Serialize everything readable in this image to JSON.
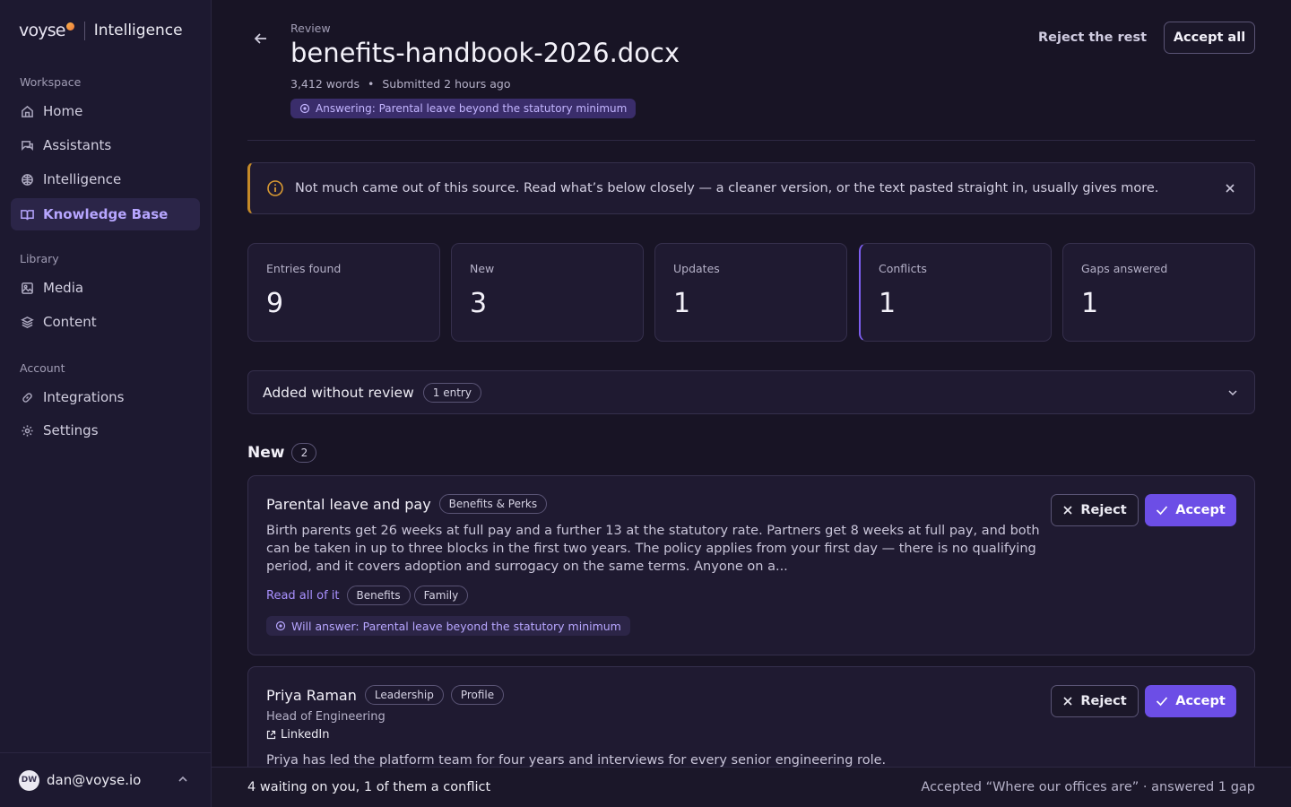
{
  "brand": {
    "logo": "voyse",
    "product": "Intelligence",
    "accent": "#f7b14c"
  },
  "sidebar": {
    "sections": [
      {
        "label": "Workspace",
        "items": [
          {
            "label": "Home",
            "icon": "home-icon"
          },
          {
            "label": "Assistants",
            "icon": "chat-icon"
          },
          {
            "label": "Intelligence",
            "icon": "brain-icon"
          },
          {
            "label": "Knowledge Base",
            "icon": "book-icon",
            "active": true
          }
        ]
      },
      {
        "label": "Library",
        "items": [
          {
            "label": "Media",
            "icon": "image-icon"
          },
          {
            "label": "Content",
            "icon": "layers-icon"
          }
        ]
      },
      {
        "label": "Account",
        "items": [
          {
            "label": "Integrations",
            "icon": "link-icon"
          },
          {
            "label": "Settings",
            "icon": "gear-icon"
          }
        ]
      }
    ],
    "user": {
      "initials": "DW",
      "email": "dan@voyse.io"
    }
  },
  "header": {
    "eyebrow": "Review",
    "title": "benefits-handbook-2026.docx",
    "word_count": "3,412 words",
    "separator": "•",
    "submitted": "Submitted 2 hours ago",
    "answering": "Answering: Parental leave beyond the statutory minimum",
    "reject_rest": "Reject the rest",
    "accept_all": "Accept all"
  },
  "notice": {
    "text": "Not much came out of this source. Read what’s below closely — a cleaner version, or the text pasted straight in, usually gives more.",
    "color": "#c58a28"
  },
  "stats": [
    {
      "label": "Entries found",
      "value": "9"
    },
    {
      "label": "New",
      "value": "3"
    },
    {
      "label": "Updates",
      "value": "1"
    },
    {
      "label": "Conflicts",
      "value": "1"
    },
    {
      "label": "Gaps answered",
      "value": "1"
    }
  ],
  "added_without_review": {
    "title": "Added without review",
    "count": "1 entry"
  },
  "new_section": {
    "title": "New",
    "count": "2"
  },
  "entries": [
    {
      "title": "Parental leave and pay",
      "category": "Benefits & Perks",
      "body": "Birth parents get 26 weeks at full pay and a further 13 at the statutory rate. Partners get 8 weeks at full pay, and both can be taken in up to three blocks in the first two years. The policy applies from your first day — there is no qualifying period, and it covers adoption and surrogacy on the same terms. Anyone on a...",
      "read_more": "Read all of it",
      "tags": [
        "Benefits",
        "Family"
      ],
      "will_answer": "Will answer: Parental leave beyond the statutory minimum",
      "reject": "Reject",
      "accept": "Accept"
    },
    {
      "title": "Priya Raman",
      "tags": [
        "Leadership",
        "Profile"
      ],
      "subtitle": "Head of Engineering",
      "link": "LinkedIn",
      "body": "Priya has led the platform team for four years and interviews for every senior engineering role.",
      "reject": "Reject",
      "accept": "Accept"
    }
  ],
  "footer": {
    "left": "4 waiting on you, 1 of them a conflict",
    "right": "Accepted “Where our offices are” · answered 1 gap"
  },
  "colors": {
    "accent": "#6c4ee6",
    "accent_text": "#b7a6ff",
    "background": "#181425",
    "warning": "#c58a28"
  }
}
